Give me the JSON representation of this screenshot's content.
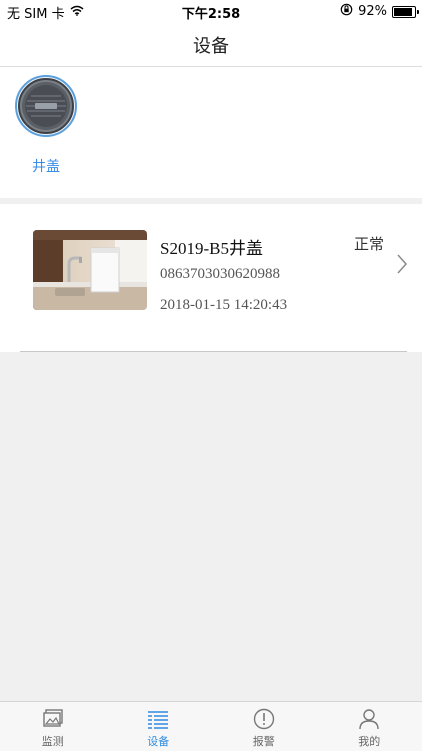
{
  "status_bar": {
    "carrier": "无 SIM 卡",
    "time": "下午2:58",
    "battery_text": "92%",
    "battery_level": 0.92
  },
  "nav": {
    "title": "设备"
  },
  "category": {
    "label": "井盖",
    "icon": "manhole-cover-icon"
  },
  "device": {
    "name": "S2019-B5井盖",
    "id": "0863703030620988",
    "time": "2018-01-15 14:20:43",
    "status": "正常"
  },
  "tabs": [
    {
      "label": "监测",
      "icon": "image-icon",
      "active": false
    },
    {
      "label": "设备",
      "icon": "list-icon",
      "active": true
    },
    {
      "label": "报警",
      "icon": "alert-icon",
      "active": false
    },
    {
      "label": "我的",
      "icon": "person-icon",
      "active": false
    }
  ],
  "colors": {
    "accent": "#2f8be0",
    "background": "#f0f0f0"
  }
}
